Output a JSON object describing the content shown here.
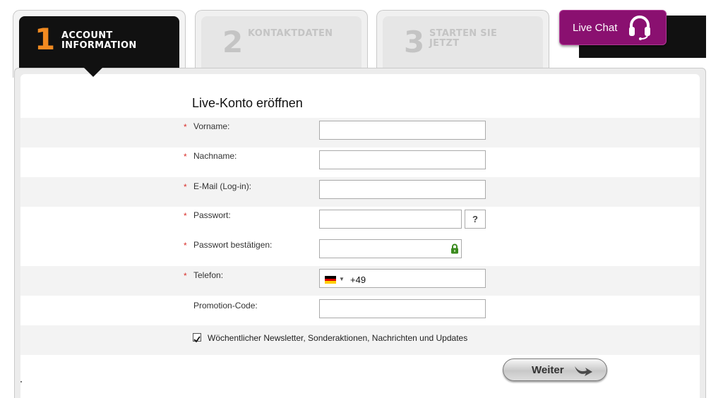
{
  "steps": [
    {
      "number": "1",
      "line1": "ACCOUNT",
      "line2": "INFORMATION"
    },
    {
      "number": "2",
      "line1": "KONTAKTDATEN",
      "line2": ""
    },
    {
      "number": "3",
      "line1": "STARTEN SIE",
      "line2": "JETZT"
    }
  ],
  "live_chat": {
    "label": "Live Chat",
    "icon": "headset-icon"
  },
  "form": {
    "title": "Live-Konto eröffnen",
    "required_mark": "*",
    "fields": {
      "first_name": {
        "label": "Vorname:",
        "value": ""
      },
      "last_name": {
        "label": "Nachname:",
        "value": ""
      },
      "email": {
        "label": "E-Mail (Log-in):",
        "value": ""
      },
      "password": {
        "label": "Passwort:",
        "value": "",
        "help": "?"
      },
      "password_confirm": {
        "label": "Passwort bestätigen:",
        "value": "",
        "icon": "lock-icon"
      },
      "phone": {
        "label": "Telefon:",
        "country_code": "+49",
        "flag": "germany-flag"
      },
      "promo": {
        "label": "Promotion-Code:",
        "value": ""
      }
    },
    "newsletter": {
      "label": "Wöchentlicher Newsletter, Sonderaktionen, Nachrichten und Updates",
      "checked": true,
      "check_glyph": "✔"
    },
    "submit": {
      "label": "Weiter",
      "icon": "arrow-icon"
    }
  },
  "colors": {
    "accent_orange": "#f18a21",
    "chat_purple": "#8a1070",
    "required_red": "#d9302c",
    "lock_green": "#3a8a1e"
  }
}
